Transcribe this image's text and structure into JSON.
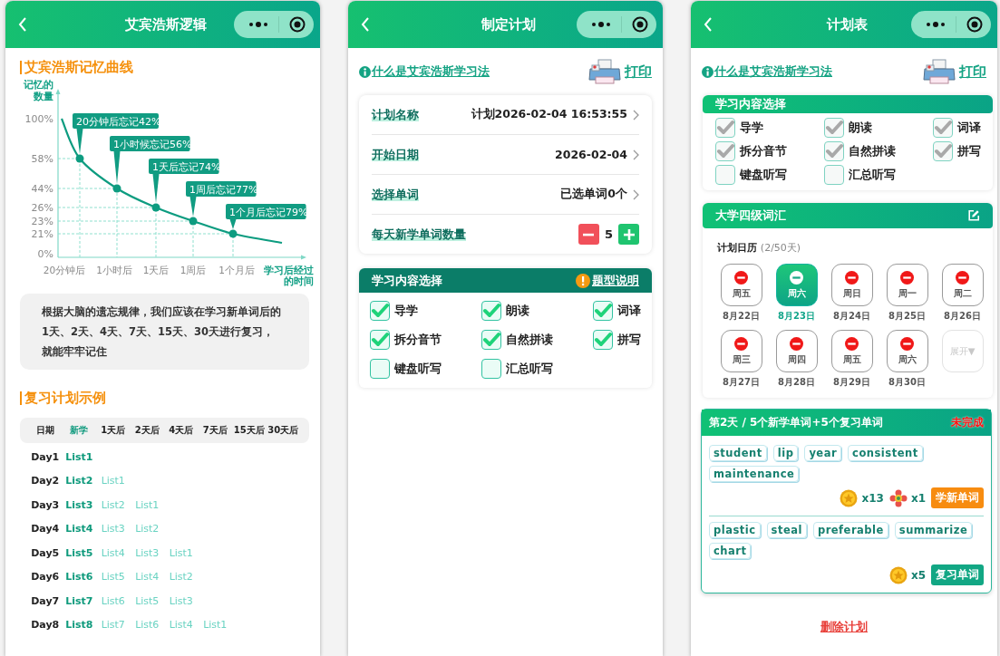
{
  "logic_screen": {
    "header": {
      "title": "艾宾浩斯逻辑"
    },
    "curve_section": {
      "title": "艾宾浩斯记忆曲线",
      "y_axis_label": "记忆的数量",
      "x_axis_label": "学习后经过的时间",
      "y_labels": [
        "100%",
        "58%",
        "44%",
        "26%",
        "23%",
        "21%",
        "0%"
      ],
      "x_labels": [
        "20分钟后",
        "1小时后",
        "1天后",
        "1周后",
        "1个月后"
      ],
      "callouts": [
        "20分钟后忘记42%",
        "1小时候忘记56%",
        "1天后忘记74%",
        "1周后忘记77%",
        "1个月后忘记79%"
      ]
    },
    "note": "根据大脑的遗忘规律，我们应该在学习新单词后的1天、2天、4天、7天、15天、30天进行复习，就能牢牢记住",
    "example_section": {
      "title": "复习计划示例",
      "columns": [
        "日期",
        "新学",
        "1天后",
        "2天后",
        "4天后",
        "7天后",
        "15天后",
        "30天后"
      ],
      "rows": [
        {
          "day": "Day1",
          "lists": [
            "List1"
          ]
        },
        {
          "day": "Day2",
          "lists": [
            "List2",
            "List1"
          ]
        },
        {
          "day": "Day3",
          "lists": [
            "List3",
            "List2",
            "List1"
          ]
        },
        {
          "day": "Day4",
          "lists": [
            "List4",
            "List3",
            "List2"
          ]
        },
        {
          "day": "Day5",
          "lists": [
            "List5",
            "List4",
            "List3",
            "List1"
          ]
        },
        {
          "day": "Day6",
          "lists": [
            "List6",
            "List5",
            "List4",
            "List2"
          ]
        },
        {
          "day": "Day7",
          "lists": [
            "List7",
            "List6",
            "List5",
            "List3"
          ]
        },
        {
          "day": "Day8",
          "lists": [
            "List8",
            "List7",
            "List6",
            "List4",
            "List1"
          ]
        }
      ]
    }
  },
  "plan_screen": {
    "header": {
      "title": "制定计划"
    },
    "info_link": "什么是艾宾浩斯学习法",
    "print_link": "打印",
    "form": [
      {
        "kind": "select",
        "label": "计划名称",
        "value": "计划2026-02-04 16:53:55"
      },
      {
        "kind": "select",
        "label": "开始日期",
        "value": "2026-02-04"
      },
      {
        "kind": "select",
        "label": "选择单词",
        "value": "已选单词0个"
      },
      {
        "kind": "stepper",
        "label": "每天新学单词数量",
        "value": "5"
      }
    ],
    "content_section": {
      "title": "学习内容选择",
      "help_link": "题型说明",
      "options": [
        {
          "label": "导学",
          "checked": true,
          "disabled": false
        },
        {
          "label": "朗读",
          "checked": true,
          "disabled": false
        },
        {
          "label": "词译",
          "checked": true,
          "disabled": false
        },
        {
          "label": "拆分音节",
          "checked": true,
          "disabled": false
        },
        {
          "label": "自然拼读",
          "checked": true,
          "disabled": false
        },
        {
          "label": "拼写",
          "checked": true,
          "disabled": false
        },
        {
          "label": "键盘听写",
          "checked": false,
          "disabled": false
        },
        {
          "label": "汇总听写",
          "checked": false,
          "disabled": false
        }
      ]
    }
  },
  "schedule_screen": {
    "header": {
      "title": "计划表"
    },
    "info_link": "什么是艾宾浩斯学习法",
    "print_link": "打印",
    "content_section": {
      "title": "学习内容选择",
      "options": [
        {
          "label": "导学",
          "checked": true,
          "disabled": true
        },
        {
          "label": "朗读",
          "checked": true,
          "disabled": true
        },
        {
          "label": "词译",
          "checked": true,
          "disabled": true
        },
        {
          "label": "拆分音节",
          "checked": true,
          "disabled": true
        },
        {
          "label": "自然拼读",
          "checked": true,
          "disabled": true
        },
        {
          "label": "拼写",
          "checked": true,
          "disabled": true
        },
        {
          "label": "键盘听写",
          "checked": false,
          "disabled": true
        },
        {
          "label": "汇总听写",
          "checked": false,
          "disabled": true
        }
      ]
    },
    "vocab_card": {
      "title": "大学四级词汇",
      "calendar_label": "计划日历",
      "calendar_progress": "(2/50天)",
      "days": [
        {
          "weekday": "周五",
          "date": "8月22日",
          "selected": false
        },
        {
          "weekday": "周六",
          "date": "8月23日",
          "selected": true
        },
        {
          "weekday": "周日",
          "date": "8月24日",
          "selected": false
        },
        {
          "weekday": "周一",
          "date": "8月25日",
          "selected": false
        },
        {
          "weekday": "周二",
          "date": "8月26日",
          "selected": false
        },
        {
          "weekday": "周三",
          "date": "8月27日",
          "selected": false
        },
        {
          "weekday": "周四",
          "date": "8月28日",
          "selected": false
        },
        {
          "weekday": "周五",
          "date": "8月29日",
          "selected": false
        },
        {
          "weekday": "周六",
          "date": "8月30日",
          "selected": false
        }
      ],
      "expand_button": "展开▼"
    },
    "task_card": {
      "title": "第2天 / 5个新学单词+5个复习单词",
      "status": "未完成",
      "groups": [
        {
          "kind": "new",
          "words": [
            "student",
            "lip",
            "year",
            "consistent",
            "maintenance"
          ],
          "rewards": [
            {
              "kind": "coin",
              "count": "x13"
            },
            {
              "kind": "flower",
              "count": "x1"
            }
          ],
          "button": "学新单词"
        },
        {
          "kind": "review",
          "words": [
            "plastic",
            "steal",
            "preferable",
            "summarize",
            "chart"
          ],
          "rewards": [
            {
              "kind": "coin",
              "count": "x5"
            }
          ],
          "button": "复习单词"
        }
      ]
    },
    "delete_link": "删除计划"
  }
}
